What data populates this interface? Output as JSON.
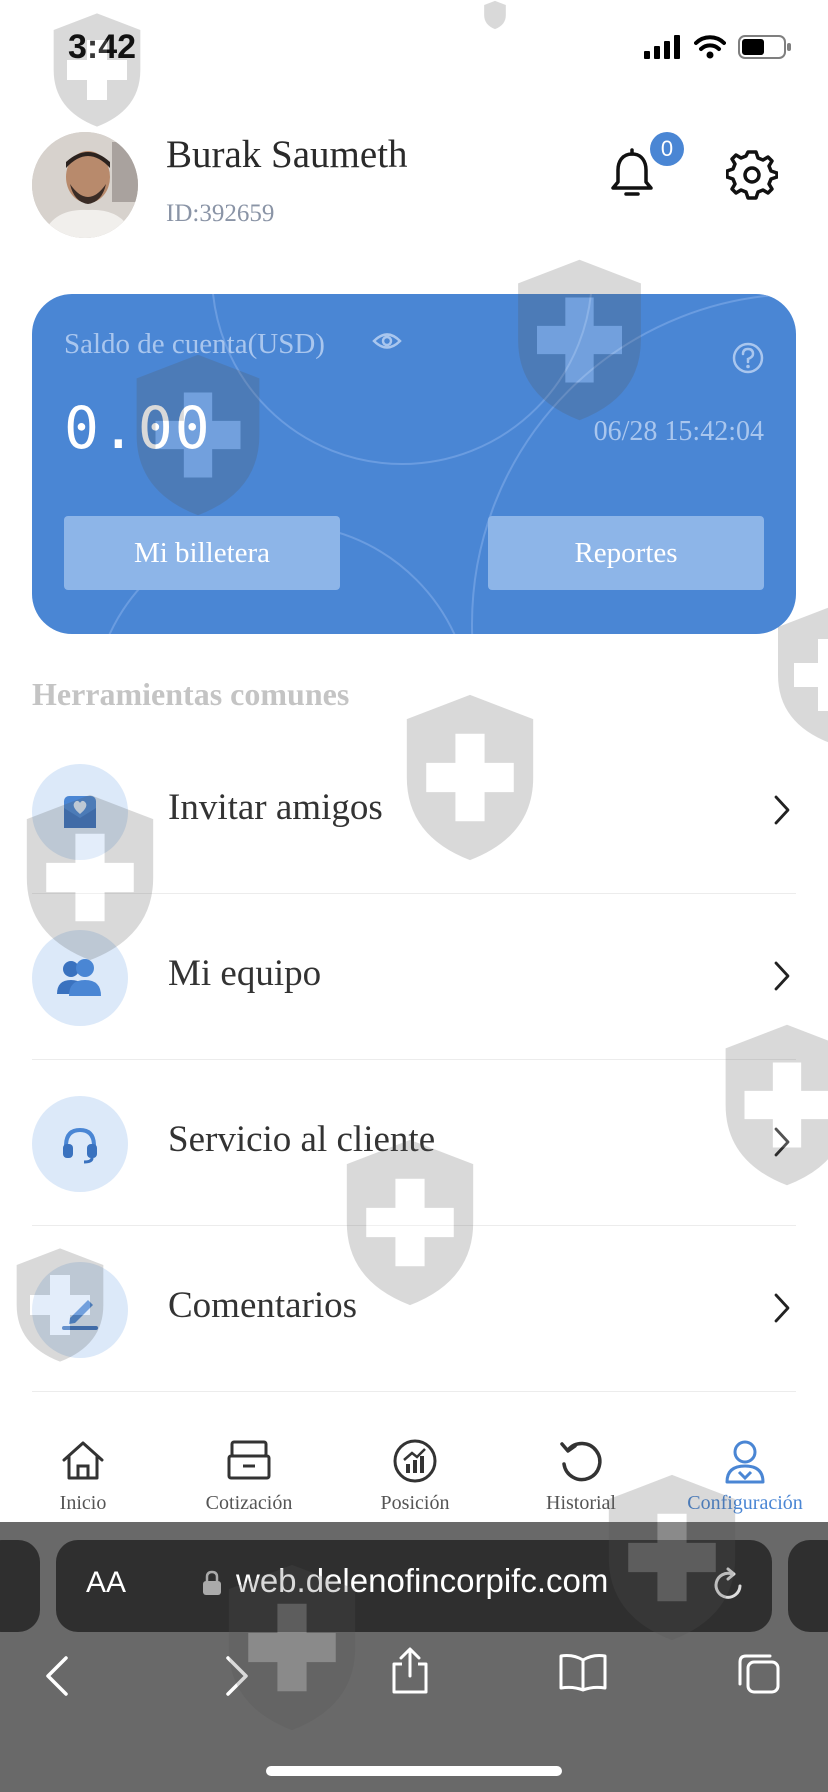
{
  "status_bar": {
    "time": "3:42"
  },
  "profile": {
    "name": "Burak Saumeth",
    "id": "ID:392659",
    "notification_count": "0"
  },
  "balance_card": {
    "label": "Saldo de cuenta(USD)",
    "value": "0.00",
    "timestamp": "06/28 15:42:04",
    "wallet_button": "Mi billetera",
    "reports_button": "Reportes",
    "color": "#4a86d4"
  },
  "tools": {
    "title": "Herramientas comunes",
    "items": [
      {
        "label": "Invitar amigos",
        "icon": "gift-heart-icon"
      },
      {
        "label": "Mi equipo",
        "icon": "team-icon"
      },
      {
        "label": "Servicio al cliente",
        "icon": "headset-icon"
      },
      {
        "label": "Comentarios",
        "icon": "pencil-icon"
      }
    ]
  },
  "tabbar": {
    "items": [
      {
        "label": "Inicio",
        "icon": "home-icon"
      },
      {
        "label": "Cotización",
        "icon": "quote-icon"
      },
      {
        "label": "Posición",
        "icon": "chart-icon"
      },
      {
        "label": "Historial",
        "icon": "history-icon"
      },
      {
        "label": "Configuración",
        "icon": "profile-icon",
        "active": true
      }
    ],
    "active_color": "#4a86d4"
  },
  "browser": {
    "text_size": "AA",
    "url": "web.delenofincorpifc.com"
  }
}
